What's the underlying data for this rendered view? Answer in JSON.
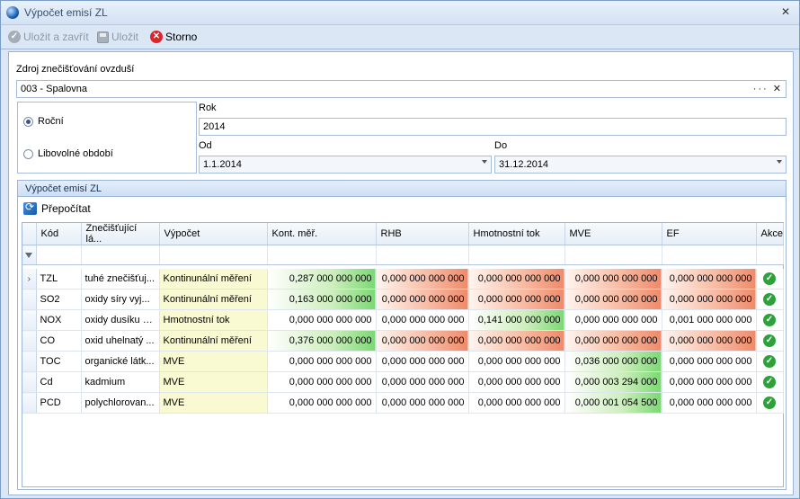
{
  "window": {
    "title": "Výpočet emisí ZL",
    "close_glyph": "✕"
  },
  "toolbar": {
    "save_close_label": "Uložit a zavřít",
    "save_label": "Uložit",
    "cancel_label": "Storno"
  },
  "source": {
    "label": "Zdroj znečišťování ovzduší",
    "value": "003 - Spalovna",
    "buttons": "··· ✕"
  },
  "period": {
    "annual_label": "Roční",
    "annual_selected": true,
    "custom_label": "Libovolné období",
    "year_label": "Rok",
    "year_value": "2014",
    "from_label": "Od",
    "from_value": "1.1.2014",
    "to_label": "Do",
    "to_value": "31.12.2014"
  },
  "calc_group": {
    "title": "Výpočet emisí ZL",
    "recalc_label": "Přepočítat"
  },
  "table": {
    "columns": [
      "Kód",
      "Znečišťující lá...",
      "Výpočet",
      "Kont. měř.",
      "RHB",
      "Hmotnostní tok",
      "MVE",
      "EF",
      "Akce"
    ],
    "rows": [
      {
        "code": "TZL",
        "name": "tuhé znečišťuj...",
        "calc": "Kontinunální měření",
        "kont": "0,287 000 000 000",
        "rhb": "0,000 000 000 000",
        "hmot": "0,000 000 000 000",
        "mve": "0,000 000 000 000",
        "ef": "0,000 000 000 000",
        "ptr": "›"
      },
      {
        "code": "SO2",
        "name": "oxidy síry vyj...",
        "calc": "Kontinunální měření",
        "kont": "0,163 000 000 000",
        "rhb": "0,000 000 000 000",
        "hmot": "0,000 000 000 000",
        "mve": "0,000 000 000 000",
        "ef": "0,000 000 000 000",
        "ptr": ""
      },
      {
        "code": "NOX",
        "name": "oxidy dusíku v...",
        "calc": "Hmotnostní tok",
        "kont": "0,000 000 000 000",
        "rhb": "0,000 000 000 000",
        "hmot": "0,141 000 000 000",
        "mve": "0,000 000 000 000",
        "ef": "0,001 000 000 000",
        "ptr": ""
      },
      {
        "code": "CO",
        "name": "oxid uhelnatý ...",
        "calc": "Kontinunální měření",
        "kont": "0,376 000 000 000",
        "rhb": "0,000 000 000 000",
        "hmot": "0,000 000 000 000",
        "mve": "0,000 000 000 000",
        "ef": "0,000 000 000 000",
        "ptr": ""
      },
      {
        "code": "TOC",
        "name": "organické látk...",
        "calc": "MVE",
        "kont": "0,000 000 000 000",
        "rhb": "0,000 000 000 000",
        "hmot": "0,000 000 000 000",
        "mve": "0,036 000 000 000",
        "ef": "0,000 000 000 000",
        "ptr": ""
      },
      {
        "code": "Cd",
        "name": "kadmium",
        "calc": "MVE",
        "kont": "0,000 000 000 000",
        "rhb": "0,000 000 000 000",
        "hmot": "0,000 000 000 000",
        "mve": "0,000 003 294 000",
        "ef": "0,000 000 000 000",
        "ptr": ""
      },
      {
        "code": "PCD",
        "name": "polychlorovan...",
        "calc": "MVE",
        "kont": "0,000 000 000 000",
        "rhb": "0,000 000 000 000",
        "hmot": "0,000 000 000 000",
        "mve": "0,000 001 054 500",
        "ef": "0,000 000 000 000",
        "ptr": ""
      }
    ],
    "cell_styles": [
      [
        "green",
        "red",
        "red",
        "red",
        "red"
      ],
      [
        "green",
        "red",
        "red",
        "red",
        "red"
      ],
      [
        "white",
        "white",
        "green",
        "white",
        "white"
      ],
      [
        "green",
        "red",
        "red",
        "red",
        "red"
      ],
      [
        "white",
        "white",
        "white",
        "green",
        "white"
      ],
      [
        "white",
        "white",
        "white",
        "green",
        "white"
      ],
      [
        "white",
        "white",
        "white",
        "green",
        "white"
      ]
    ]
  }
}
